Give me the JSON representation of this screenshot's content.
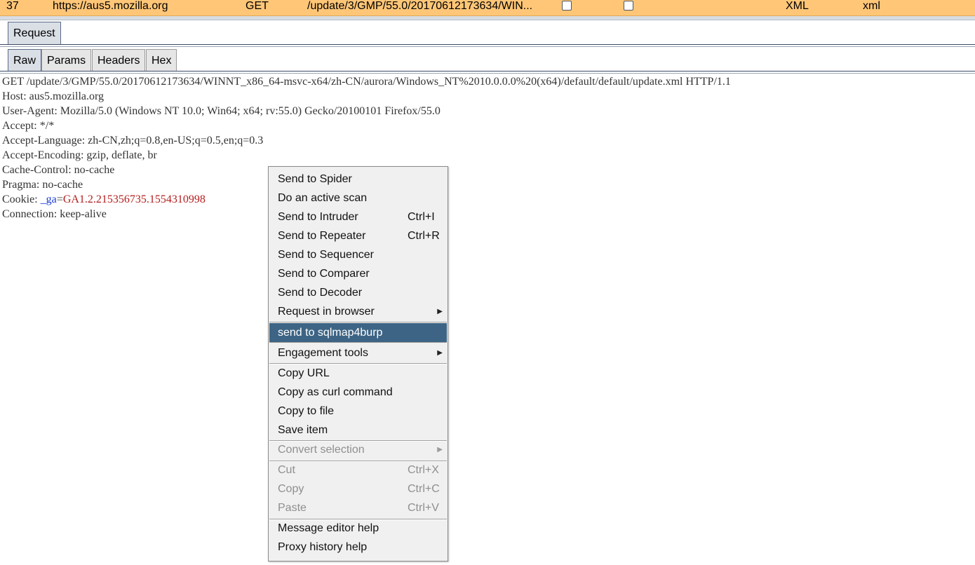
{
  "history_row": {
    "number": "37",
    "host": "https://aus5.mozilla.org",
    "method": "GET",
    "url": "/update/3/GMP/55.0/20170612173634/WIN...",
    "mime": "XML",
    "extension": "xml"
  },
  "tabs": {
    "request": "Request",
    "raw": "Raw",
    "params": "Params",
    "headers": "Headers",
    "hex": "Hex"
  },
  "request_lines": [
    "GET /update/3/GMP/55.0/20170612173634/WINNT_x86_64-msvc-x64/zh-CN/aurora/Windows_NT%2010.0.0.0%20(x64)/default/default/update.xml HTTP/1.1",
    "Host: aus5.mozilla.org",
    "User-Agent: Mozilla/5.0 (Windows NT 10.0; Win64; x64; rv:55.0) Gecko/20100101 Firefox/55.0",
    "Accept: */*",
    "Accept-Language: zh-CN,zh;q=0.8,en-US;q=0.5,en;q=0.3",
    "Accept-Encoding: gzip, deflate, br",
    "Cache-Control: no-cache",
    "Pragma: no-cache"
  ],
  "cookie_line": {
    "prefix": "Cookie: ",
    "name": "_ga",
    "equals": "=",
    "value": "GA1.2.215356735.1554310998"
  },
  "connection_line": "Connection: keep-alive",
  "context_menu": {
    "send_to_spider": "Send to Spider",
    "active_scan": "Do an active scan",
    "send_to_intruder": "Send to Intruder",
    "send_to_intruder_shortcut": "Ctrl+I",
    "send_to_repeater": "Send to Repeater",
    "send_to_repeater_shortcut": "Ctrl+R",
    "send_to_sequencer": "Send to Sequencer",
    "send_to_comparer": "Send to Comparer",
    "send_to_decoder": "Send to Decoder",
    "request_in_browser": "Request in browser",
    "send_to_sqlmap4burp": "send to sqlmap4burp",
    "engagement_tools": "Engagement tools",
    "copy_url": "Copy URL",
    "copy_as_curl": "Copy as curl command",
    "copy_to_file": "Copy to file",
    "save_item": "Save item",
    "convert_selection": "Convert selection",
    "cut": "Cut",
    "cut_shortcut": "Ctrl+X",
    "copy": "Copy",
    "copy_shortcut": "Ctrl+C",
    "paste": "Paste",
    "paste_shortcut": "Ctrl+V",
    "message_editor_help": "Message editor help",
    "proxy_history_help": "Proxy history help"
  },
  "colors": {
    "selected_row": "#ffc677",
    "menu_highlight": "#3d6484",
    "cookie_name": "#1a3bd6",
    "cookie_value": "#b51c1c"
  }
}
